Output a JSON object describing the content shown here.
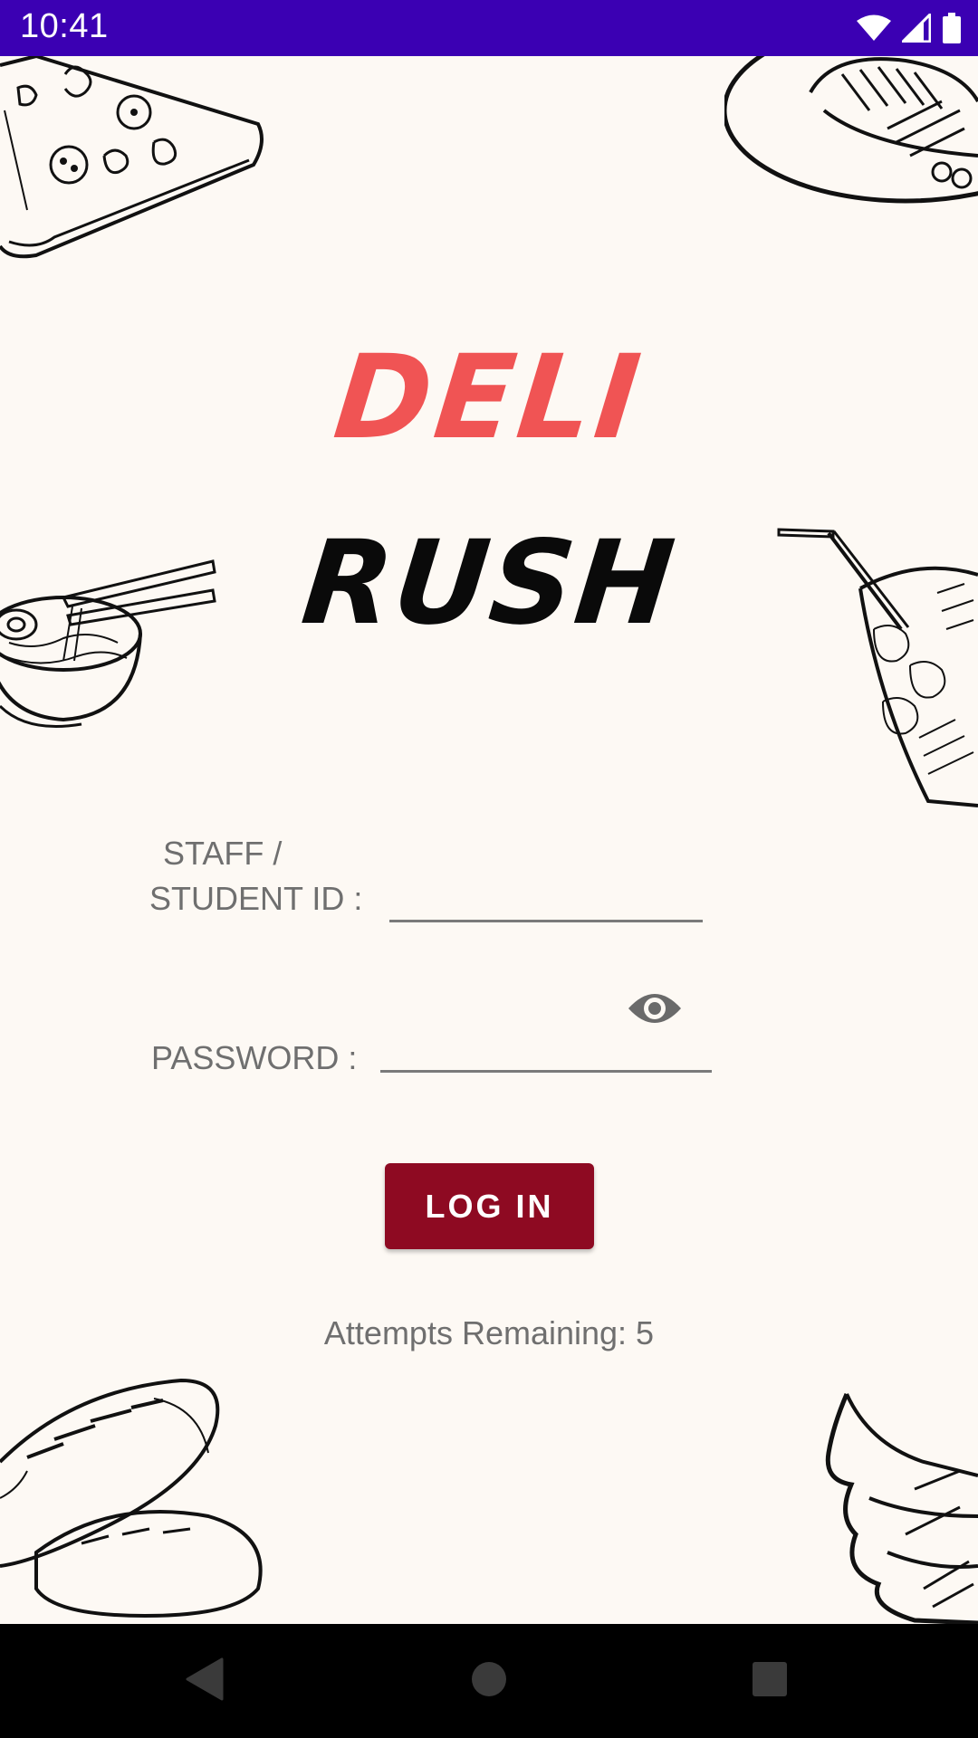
{
  "status_bar": {
    "time": "10:41",
    "color": "#3b00b3",
    "icons": [
      "wifi-icon",
      "signal-icon",
      "battery-icon"
    ]
  },
  "title": {
    "line1": "DELI",
    "line2": "RUSH",
    "line1_color": "#f05454",
    "line2_color": "#0a0a0a"
  },
  "form": {
    "id_label_line1": "STAFF /",
    "id_label_line2": "STUDENT ID :",
    "id_value": "",
    "password_label": "PASSWORD :",
    "password_value": "",
    "password_toggle_icon": "eye-icon"
  },
  "login_button": {
    "label": "LOG IN",
    "color": "#8e0a22"
  },
  "attempts": {
    "text": "Attempts Remaining: 5"
  },
  "background_doodles": [
    "pizza-slice",
    "steak-plate",
    "ramen-bowl",
    "iced-drink",
    "bread-loaves",
    "ice-cream-cone"
  ],
  "nav_bar": {
    "icons": [
      "back-icon",
      "home-icon",
      "recents-icon"
    ]
  }
}
